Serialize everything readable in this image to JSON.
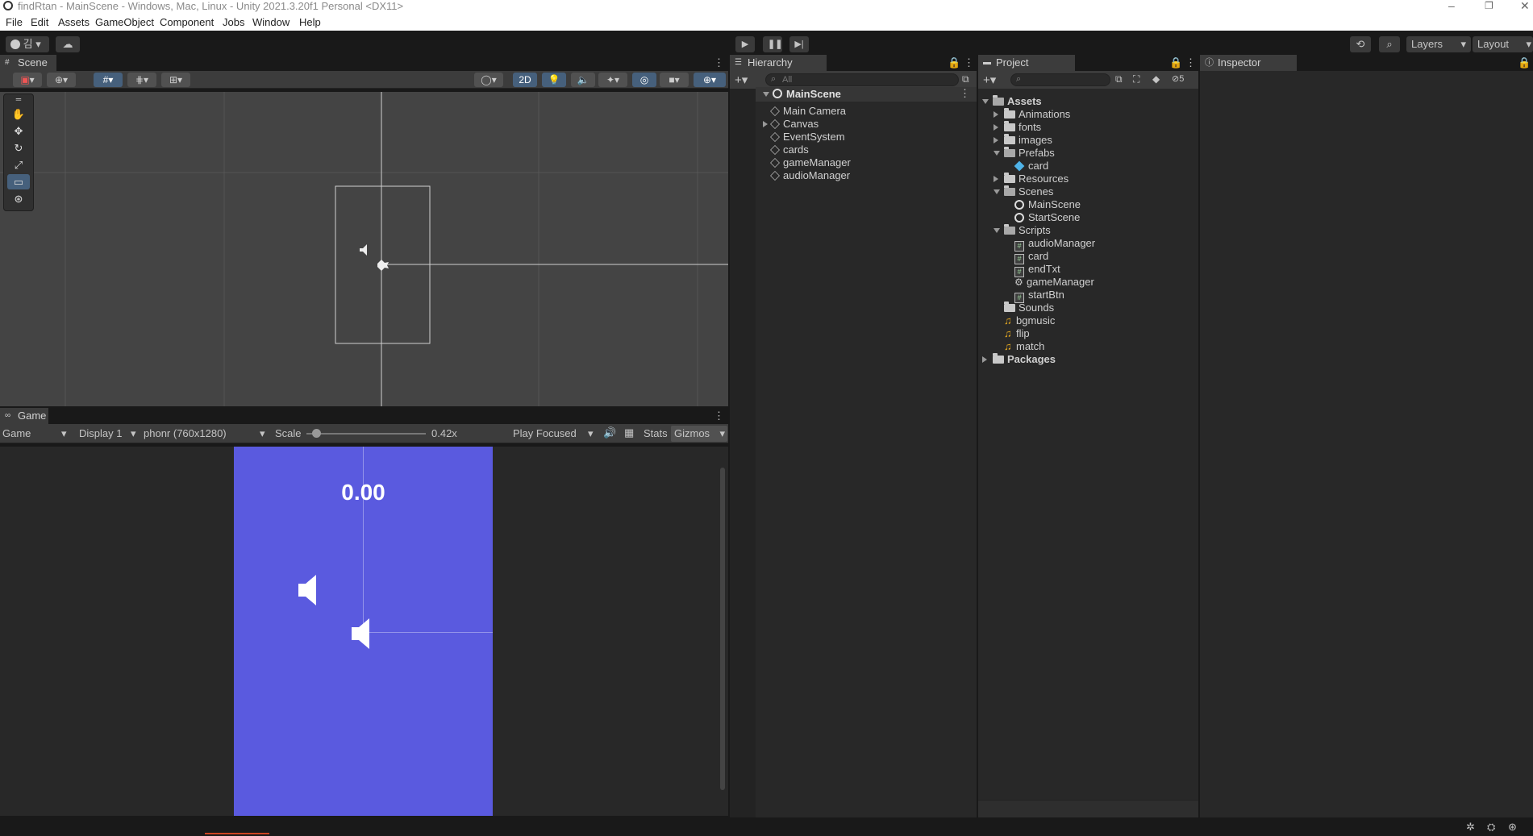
{
  "window": {
    "title": "findRtan - MainScene - Windows, Mac, Linux - Unity 2021.3.20f1 Personal <DX11>"
  },
  "menu": [
    "File",
    "Edit",
    "Assets",
    "GameObject",
    "Component",
    "Jobs",
    "Window",
    "Help"
  ],
  "toolbar": {
    "account_label": "김",
    "layers_label": "Layers",
    "layout_label": "Layout"
  },
  "scene": {
    "tab_label": "Scene",
    "mode_2d_label": "2D"
  },
  "game": {
    "tab_label": "Game",
    "view_select": "Game",
    "display_select": "Display 1",
    "resolution_select": "phonr (760x1280)",
    "scale_label": "Scale",
    "scale_value": "0.42x",
    "scale_fraction": 0.05,
    "play_focused": "Play Focused",
    "stats_label": "Stats",
    "gizmos_label": "Gizmos",
    "timer_text": "0.00",
    "bg_color": "#5a5adf"
  },
  "hierarchy": {
    "tab_label": "Hierarchy",
    "search_placeholder": "All",
    "root": "MainScene",
    "items": [
      {
        "label": "Main Camera",
        "expandable": false
      },
      {
        "label": "Canvas",
        "expandable": true
      },
      {
        "label": "EventSystem",
        "expandable": false
      },
      {
        "label": "cards",
        "expandable": false
      },
      {
        "label": "gameManager",
        "expandable": false
      },
      {
        "label": "audioManager",
        "expandable": false
      }
    ]
  },
  "project": {
    "tab_label": "Project",
    "hidden_count": "5",
    "tree": [
      {
        "label": "Assets",
        "kind": "folder-open",
        "depth": 0,
        "bold": true,
        "arrow": "d"
      },
      {
        "label": "Animations",
        "kind": "folder",
        "depth": 1,
        "arrow": "r"
      },
      {
        "label": "fonts",
        "kind": "folder",
        "depth": 1,
        "arrow": "r"
      },
      {
        "label": "images",
        "kind": "folder",
        "depth": 1,
        "arrow": "r"
      },
      {
        "label": "Prefabs",
        "kind": "folder-open",
        "depth": 1,
        "arrow": "d"
      },
      {
        "label": "card",
        "kind": "prefab",
        "depth": 2,
        "arrow": ""
      },
      {
        "label": "Resources",
        "kind": "folder",
        "depth": 1,
        "arrow": "r"
      },
      {
        "label": "Scenes",
        "kind": "folder-open",
        "depth": 1,
        "arrow": "d"
      },
      {
        "label": "MainScene",
        "kind": "scene",
        "depth": 2,
        "arrow": ""
      },
      {
        "label": "StartScene",
        "kind": "scene",
        "depth": 2,
        "arrow": ""
      },
      {
        "label": "Scripts",
        "kind": "folder-open",
        "depth": 1,
        "arrow": "d"
      },
      {
        "label": "audioManager",
        "kind": "script",
        "depth": 2,
        "arrow": ""
      },
      {
        "label": "card",
        "kind": "script",
        "depth": 2,
        "arrow": ""
      },
      {
        "label": "endTxt",
        "kind": "script",
        "depth": 2,
        "arrow": ""
      },
      {
        "label": "gameManager",
        "kind": "gear",
        "depth": 2,
        "arrow": ""
      },
      {
        "label": "startBtn",
        "kind": "script",
        "depth": 2,
        "arrow": ""
      },
      {
        "label": "Sounds",
        "kind": "folder",
        "depth": 1,
        "arrow": ""
      },
      {
        "label": "bgmusic",
        "kind": "audio",
        "depth": 1,
        "arrow": ""
      },
      {
        "label": "flip",
        "kind": "audio",
        "depth": 1,
        "arrow": ""
      },
      {
        "label": "match",
        "kind": "audio",
        "depth": 1,
        "arrow": ""
      },
      {
        "label": "Packages",
        "kind": "folder",
        "depth": 0,
        "bold": true,
        "arrow": "r"
      }
    ]
  },
  "inspector": {
    "tab_label": "Inspector"
  }
}
